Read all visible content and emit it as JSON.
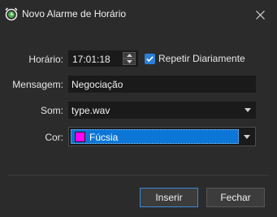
{
  "window": {
    "title": "Novo Alarme de Horário",
    "app_icon": "alarm-clock-icon",
    "close_icon": "close-icon"
  },
  "form": {
    "time_label": "Horário:",
    "time_value": "17:01:18",
    "repeat_label": "Repetir Diariamente",
    "repeat_checked": true,
    "message_label": "Mensagem:",
    "message_value": "Negociação",
    "sound_label": "Som:",
    "sound_value": "type.wav",
    "color_label": "Cor:",
    "color_value": "Fúcsia",
    "color_swatch": "#ff00ff"
  },
  "buttons": {
    "insert_label": "Inserir",
    "close_label": "Fechar"
  },
  "colors": {
    "background": "#2b2b2b",
    "field": "#1a1a1a",
    "accent": "#0c76d6"
  }
}
